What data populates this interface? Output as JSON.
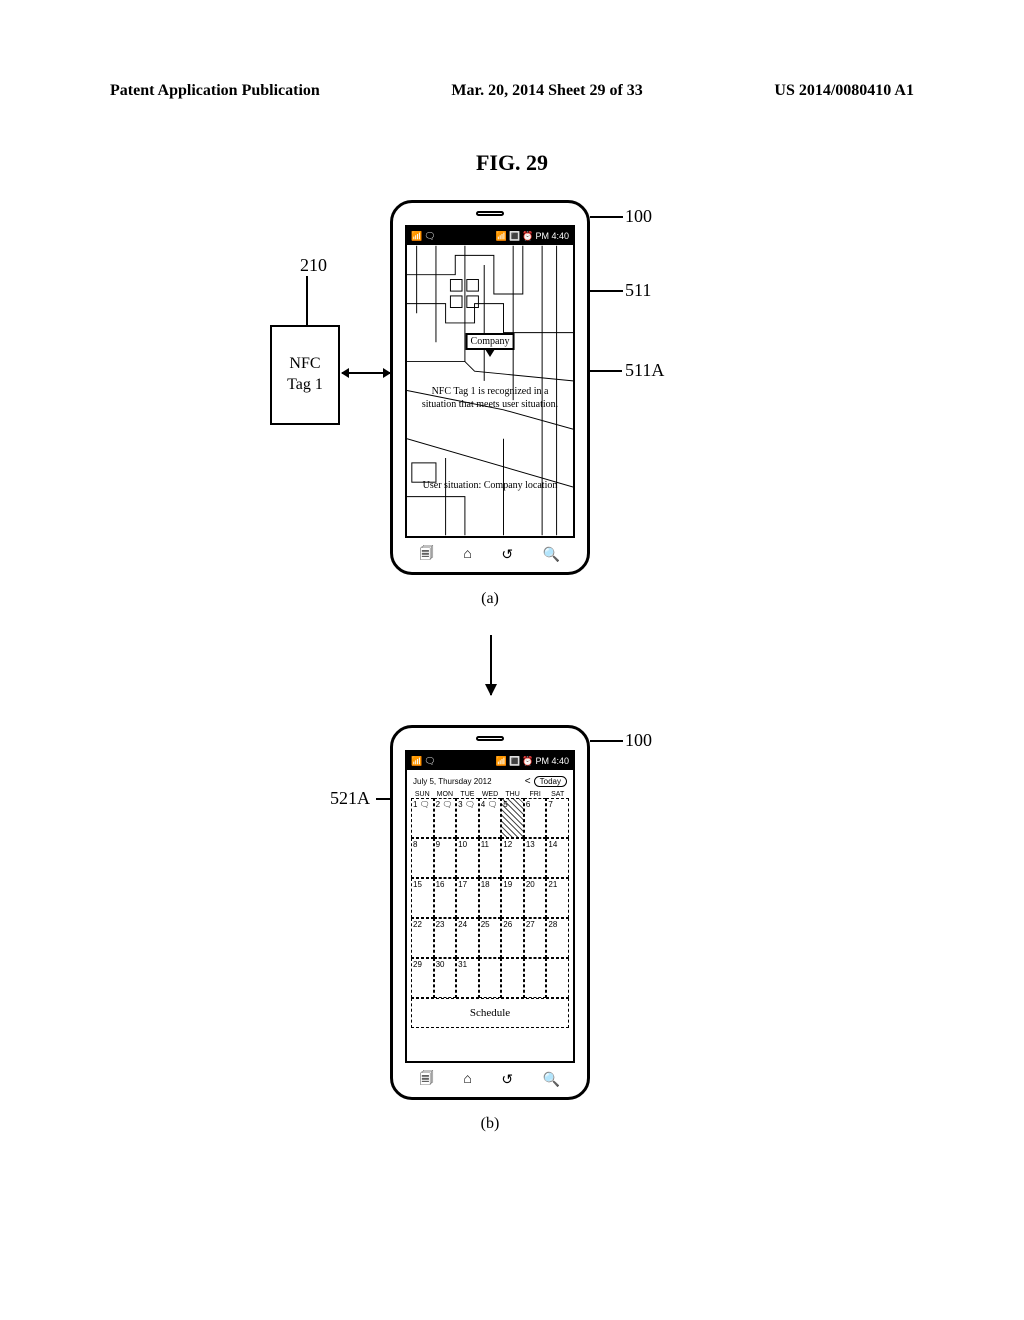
{
  "header": {
    "left": "Patent Application Publication",
    "center": "Mar. 20, 2014  Sheet 29 of 33",
    "right": "US 2014/0080410 A1"
  },
  "figure": {
    "title": "FIG. 29"
  },
  "labels": {
    "ref_100a": "100",
    "ref_100b": "100",
    "ref_210": "210",
    "ref_511": "511",
    "ref_511A": "511A",
    "ref_521A": "521A",
    "sub_a": "(a)",
    "sub_b": "(b)"
  },
  "nfc_tag": {
    "line1": "NFC",
    "line2": "Tag 1"
  },
  "status": {
    "time": "PM 4:40",
    "wifi_icon": "📶",
    "chat_icon": "🗨",
    "signal_icon": "📶",
    "battery_icon": "🔳",
    "alarm_icon": "⏰"
  },
  "nav": {
    "recent": "🗐",
    "home": "⌂",
    "back": "↺",
    "search": "🔍"
  },
  "map": {
    "company_label": "Company",
    "nfc_msg": "NFC Tag 1 is recognized in a situation that meets user situation.",
    "user_situation": "User situation: Company location"
  },
  "calendar": {
    "date_label": "July 5, Thursday 2012",
    "today_label": "Today",
    "left_arrow": "<",
    "days": [
      "SUN",
      "MON",
      "TUE",
      "WED",
      "THU",
      "FRI",
      "SAT"
    ],
    "weeks": [
      [
        {
          "n": "1",
          "b": true
        },
        {
          "n": "2",
          "b": true
        },
        {
          "n": "3",
          "b": true
        },
        {
          "n": "4",
          "b": true
        },
        {
          "n": "5",
          "today": true
        },
        {
          "n": "6"
        },
        {
          "n": "7"
        }
      ],
      [
        {
          "n": "8"
        },
        {
          "n": "9"
        },
        {
          "n": "10"
        },
        {
          "n": "11"
        },
        {
          "n": "12"
        },
        {
          "n": "13"
        },
        {
          "n": "14"
        }
      ],
      [
        {
          "n": "15"
        },
        {
          "n": "16"
        },
        {
          "n": "17"
        },
        {
          "n": "18"
        },
        {
          "n": "19"
        },
        {
          "n": "20"
        },
        {
          "n": "21"
        }
      ],
      [
        {
          "n": "22"
        },
        {
          "n": "23"
        },
        {
          "n": "24"
        },
        {
          "n": "25"
        },
        {
          "n": "26"
        },
        {
          "n": "27"
        },
        {
          "n": "28"
        }
      ],
      [
        {
          "n": "29"
        },
        {
          "n": "30"
        },
        {
          "n": "31"
        },
        {
          "n": ""
        },
        {
          "n": ""
        },
        {
          "n": ""
        },
        {
          "n": ""
        }
      ]
    ],
    "schedule_label": "Schedule"
  }
}
